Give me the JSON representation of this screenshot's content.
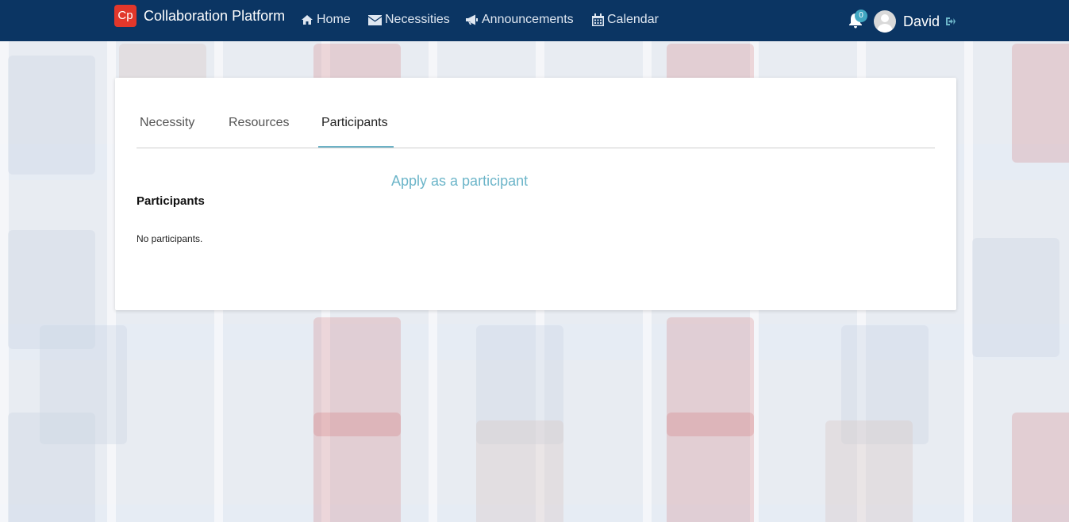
{
  "navbar": {
    "logo_text": "Cp",
    "brand_title": "Collaboration Platform",
    "items": [
      {
        "label": "Home",
        "icon": "home-icon"
      },
      {
        "label": "Necessities",
        "icon": "envelope-icon"
      },
      {
        "label": "Announcements",
        "icon": "bullhorn-icon"
      },
      {
        "label": "Calendar",
        "icon": "calendar-icon"
      }
    ],
    "notification_count": "0",
    "user_name": "David",
    "colors": {
      "background": "#0b3563",
      "logo": "#e2372b",
      "badge": "#41a7c2"
    }
  },
  "tabs": [
    {
      "label": "Necessity",
      "active": false
    },
    {
      "label": "Resources",
      "active": false
    },
    {
      "label": "Participants",
      "active": true
    }
  ],
  "content": {
    "apply_link": "Apply as a participant",
    "heading": "Participants",
    "empty_message": "No participants.",
    "accent_color": "#6cb5c9"
  }
}
